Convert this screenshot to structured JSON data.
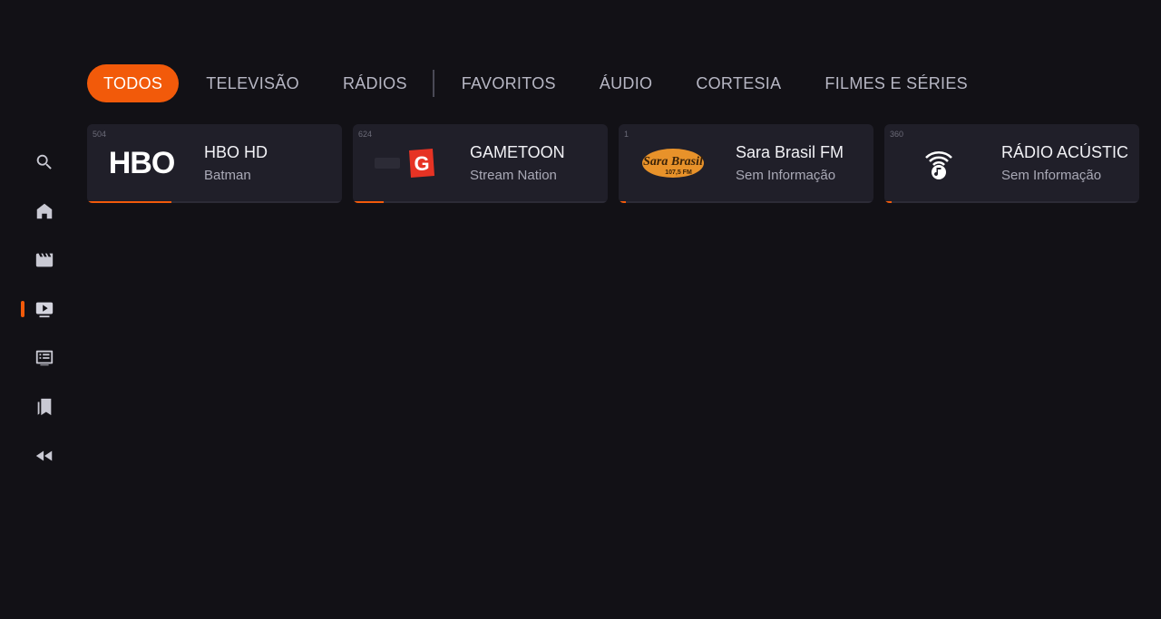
{
  "colors": {
    "background": "#121116",
    "accent": "#f25a0a",
    "card": "#201f29"
  },
  "sidebar": {
    "items": [
      {
        "icon": "search-icon"
      },
      {
        "icon": "home-icon"
      },
      {
        "icon": "movie-icon"
      },
      {
        "icon": "play-video-icon",
        "active": true
      },
      {
        "icon": "list-icon"
      },
      {
        "icon": "bookmarks-icon"
      },
      {
        "icon": "rewind-icon"
      }
    ]
  },
  "tabs": [
    {
      "label": "TODOS",
      "active": true
    },
    {
      "label": "TELEVISÃO"
    },
    {
      "label": "RÁDIOS"
    },
    {
      "label": "FAVORITOS"
    },
    {
      "label": "ÁUDIO"
    },
    {
      "label": "CORTESIA"
    },
    {
      "label": "FILMES E SÉRIES"
    }
  ],
  "cards": [
    {
      "number": "504",
      "logo_text": "HBO",
      "title": "HBO HD",
      "subtitle": "Batman",
      "progress": 0.33
    },
    {
      "number": "624",
      "logo_text": "G",
      "title": "GAMETOON",
      "subtitle": "Stream Nation",
      "progress": 0.12
    },
    {
      "number": "1",
      "logo_text_main": "Sara Brasil",
      "logo_text_sub": "107,5 FM",
      "title": "Sara Brasil FM",
      "subtitle": "Sem Informação",
      "progress": 0.03
    },
    {
      "number": "360",
      "logo_icon": "radio-podcast-icon",
      "title": "RÁDIO ACÚSTICO",
      "subtitle": "Sem Informação",
      "progress": 0.03
    }
  ]
}
